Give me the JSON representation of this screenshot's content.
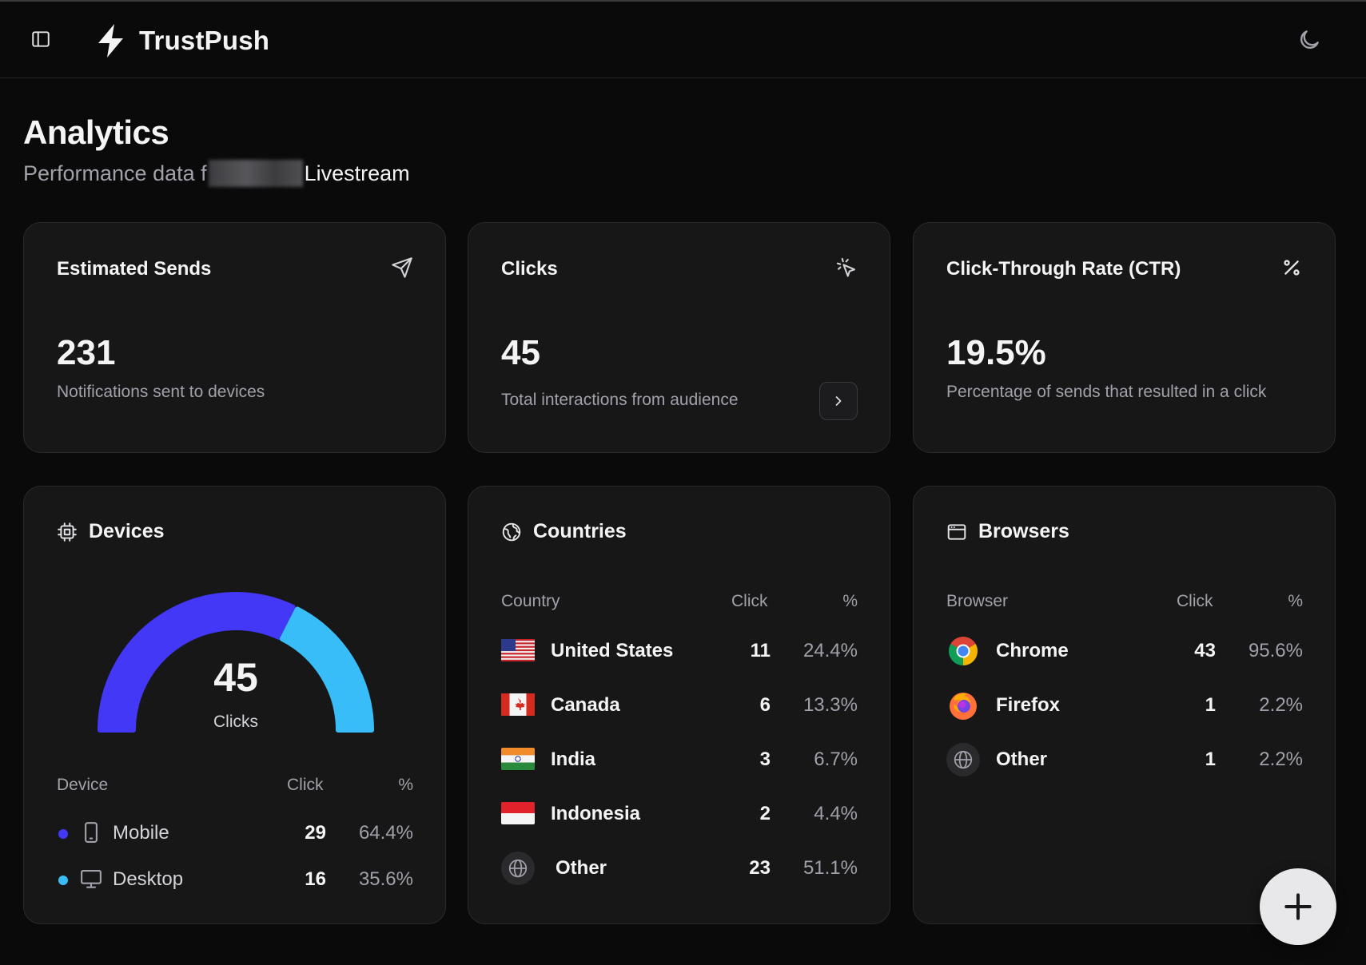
{
  "app": {
    "name": "TrustPush"
  },
  "page": {
    "title": "Analytics",
    "subtitle_prefix": "Performance data f",
    "subtitle_suffix": "Livestream"
  },
  "stats": [
    {
      "title": "Estimated Sends",
      "value": "231",
      "desc": "Notifications sent to devices",
      "icon": "send-icon"
    },
    {
      "title": "Clicks",
      "value": "45",
      "desc": "Total interactions from audience",
      "icon": "pointer-click-icon"
    },
    {
      "title": "Click-Through Rate (CTR)",
      "value": "19.5%",
      "desc": "Percentage of sends that resulted in a click",
      "icon": "percent-icon"
    }
  ],
  "devices": {
    "title": "Devices",
    "gauge_value": "45",
    "gauge_label": "Clicks",
    "columns": [
      "Device",
      "Click",
      "%"
    ],
    "rows": [
      {
        "label": "Mobile",
        "clicks": "29",
        "pct": "64.4%",
        "fraction": 0.644,
        "color": "#4338f5",
        "icon": "smartphone-icon"
      },
      {
        "label": "Desktop",
        "clicks": "16",
        "pct": "35.6%",
        "fraction": 0.356,
        "color": "#38bdf8",
        "icon": "monitor-icon"
      }
    ]
  },
  "countries": {
    "title": "Countries",
    "columns": [
      "Country",
      "Click",
      "%"
    ],
    "rows": [
      {
        "label": "United States",
        "clicks": "11",
        "pct": "24.4%",
        "icon": "us-flag-icon"
      },
      {
        "label": "Canada",
        "clicks": "6",
        "pct": "13.3%",
        "icon": "canada-flag-icon"
      },
      {
        "label": "India",
        "clicks": "3",
        "pct": "6.7%",
        "icon": "india-flag-icon"
      },
      {
        "label": "Indonesia",
        "clicks": "2",
        "pct": "4.4%",
        "icon": "indonesia-flag-icon"
      },
      {
        "label": "Other",
        "clicks": "23",
        "pct": "51.1%",
        "icon": "globe-icon"
      }
    ]
  },
  "browsers": {
    "title": "Browsers",
    "columns": [
      "Browser",
      "Click",
      "%"
    ],
    "rows": [
      {
        "label": "Chrome",
        "clicks": "43",
        "pct": "95.6%",
        "icon": "chrome-icon"
      },
      {
        "label": "Firefox",
        "clicks": "1",
        "pct": "2.2%",
        "icon": "firefox-icon"
      },
      {
        "label": "Other",
        "clicks": "1",
        "pct": "2.2%",
        "icon": "globe-icon"
      }
    ]
  },
  "colors": {
    "background": "#0a0a0b",
    "card": "#171718",
    "mobile": "#4338f5",
    "desktop": "#38bdf8"
  }
}
